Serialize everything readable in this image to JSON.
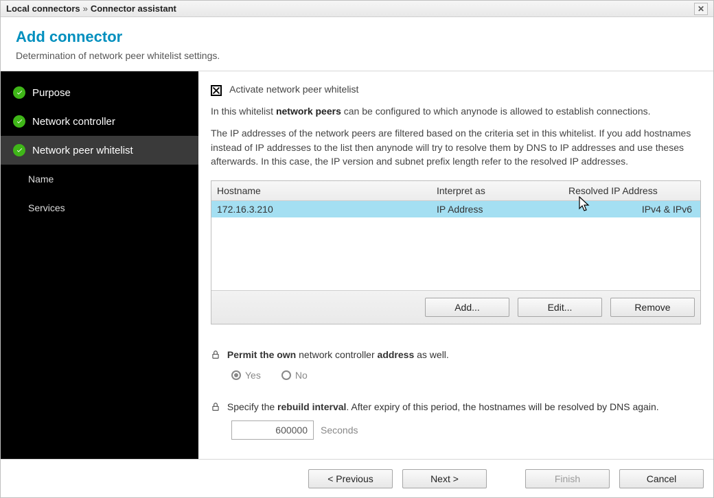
{
  "title": {
    "breadcrumb_root": "Local connectors",
    "breadcrumb_sep": "»",
    "breadcrumb_sub": "Connector assistant"
  },
  "header": {
    "title": "Add connector",
    "desc": "Determination of network peer whitelist settings."
  },
  "sidebar": {
    "steps": [
      {
        "label": "Purpose",
        "done": true
      },
      {
        "label": "Network controller",
        "done": true
      },
      {
        "label": "Network peer whitelist",
        "done": true,
        "active": true
      },
      {
        "label": "Name",
        "sub": true
      },
      {
        "label": "Services",
        "sub": true
      }
    ]
  },
  "main": {
    "activate_label": "Activate network peer whitelist",
    "intro_pre": "In this whitelist ",
    "intro_bold": "network peers",
    "intro_post": " can be configured to which anynode is allowed to establish connections.",
    "desc2": "The IP addresses of the network peers are filtered based on the criteria set in this whitelist. If you add hostnames instead of IP addresses to the list then anynode will try to resolve them by DNS to IP addresses and use theses afterwards. In this case, the IP version and subnet prefix length refer to the resolved IP addresses.",
    "table": {
      "headers": {
        "host": "Hostname",
        "interp": "Interpret as",
        "resolved": "Resolved IP Address"
      },
      "rows": [
        {
          "host": "172.16.3.210",
          "interp": "IP Address",
          "resolved": "IPv4 & IPv6",
          "selected": true
        }
      ],
      "buttons": {
        "add": "Add...",
        "edit": "Edit...",
        "remove": "Remove"
      }
    },
    "permit": {
      "pre": "Permit the own",
      "mid": " network controller ",
      "bold_end": "address",
      "post": " as well.",
      "yes": "Yes",
      "no": "No",
      "value": "yes"
    },
    "interval": {
      "pre": "Specify the ",
      "bold": "rebuild interval",
      "post": ". After expiry of this period, the hostnames will be resolved by DNS again.",
      "value": "600000",
      "unit": "Seconds"
    }
  },
  "footer": {
    "prev": "< Previous",
    "next": "Next >",
    "finish": "Finish",
    "cancel": "Cancel"
  }
}
